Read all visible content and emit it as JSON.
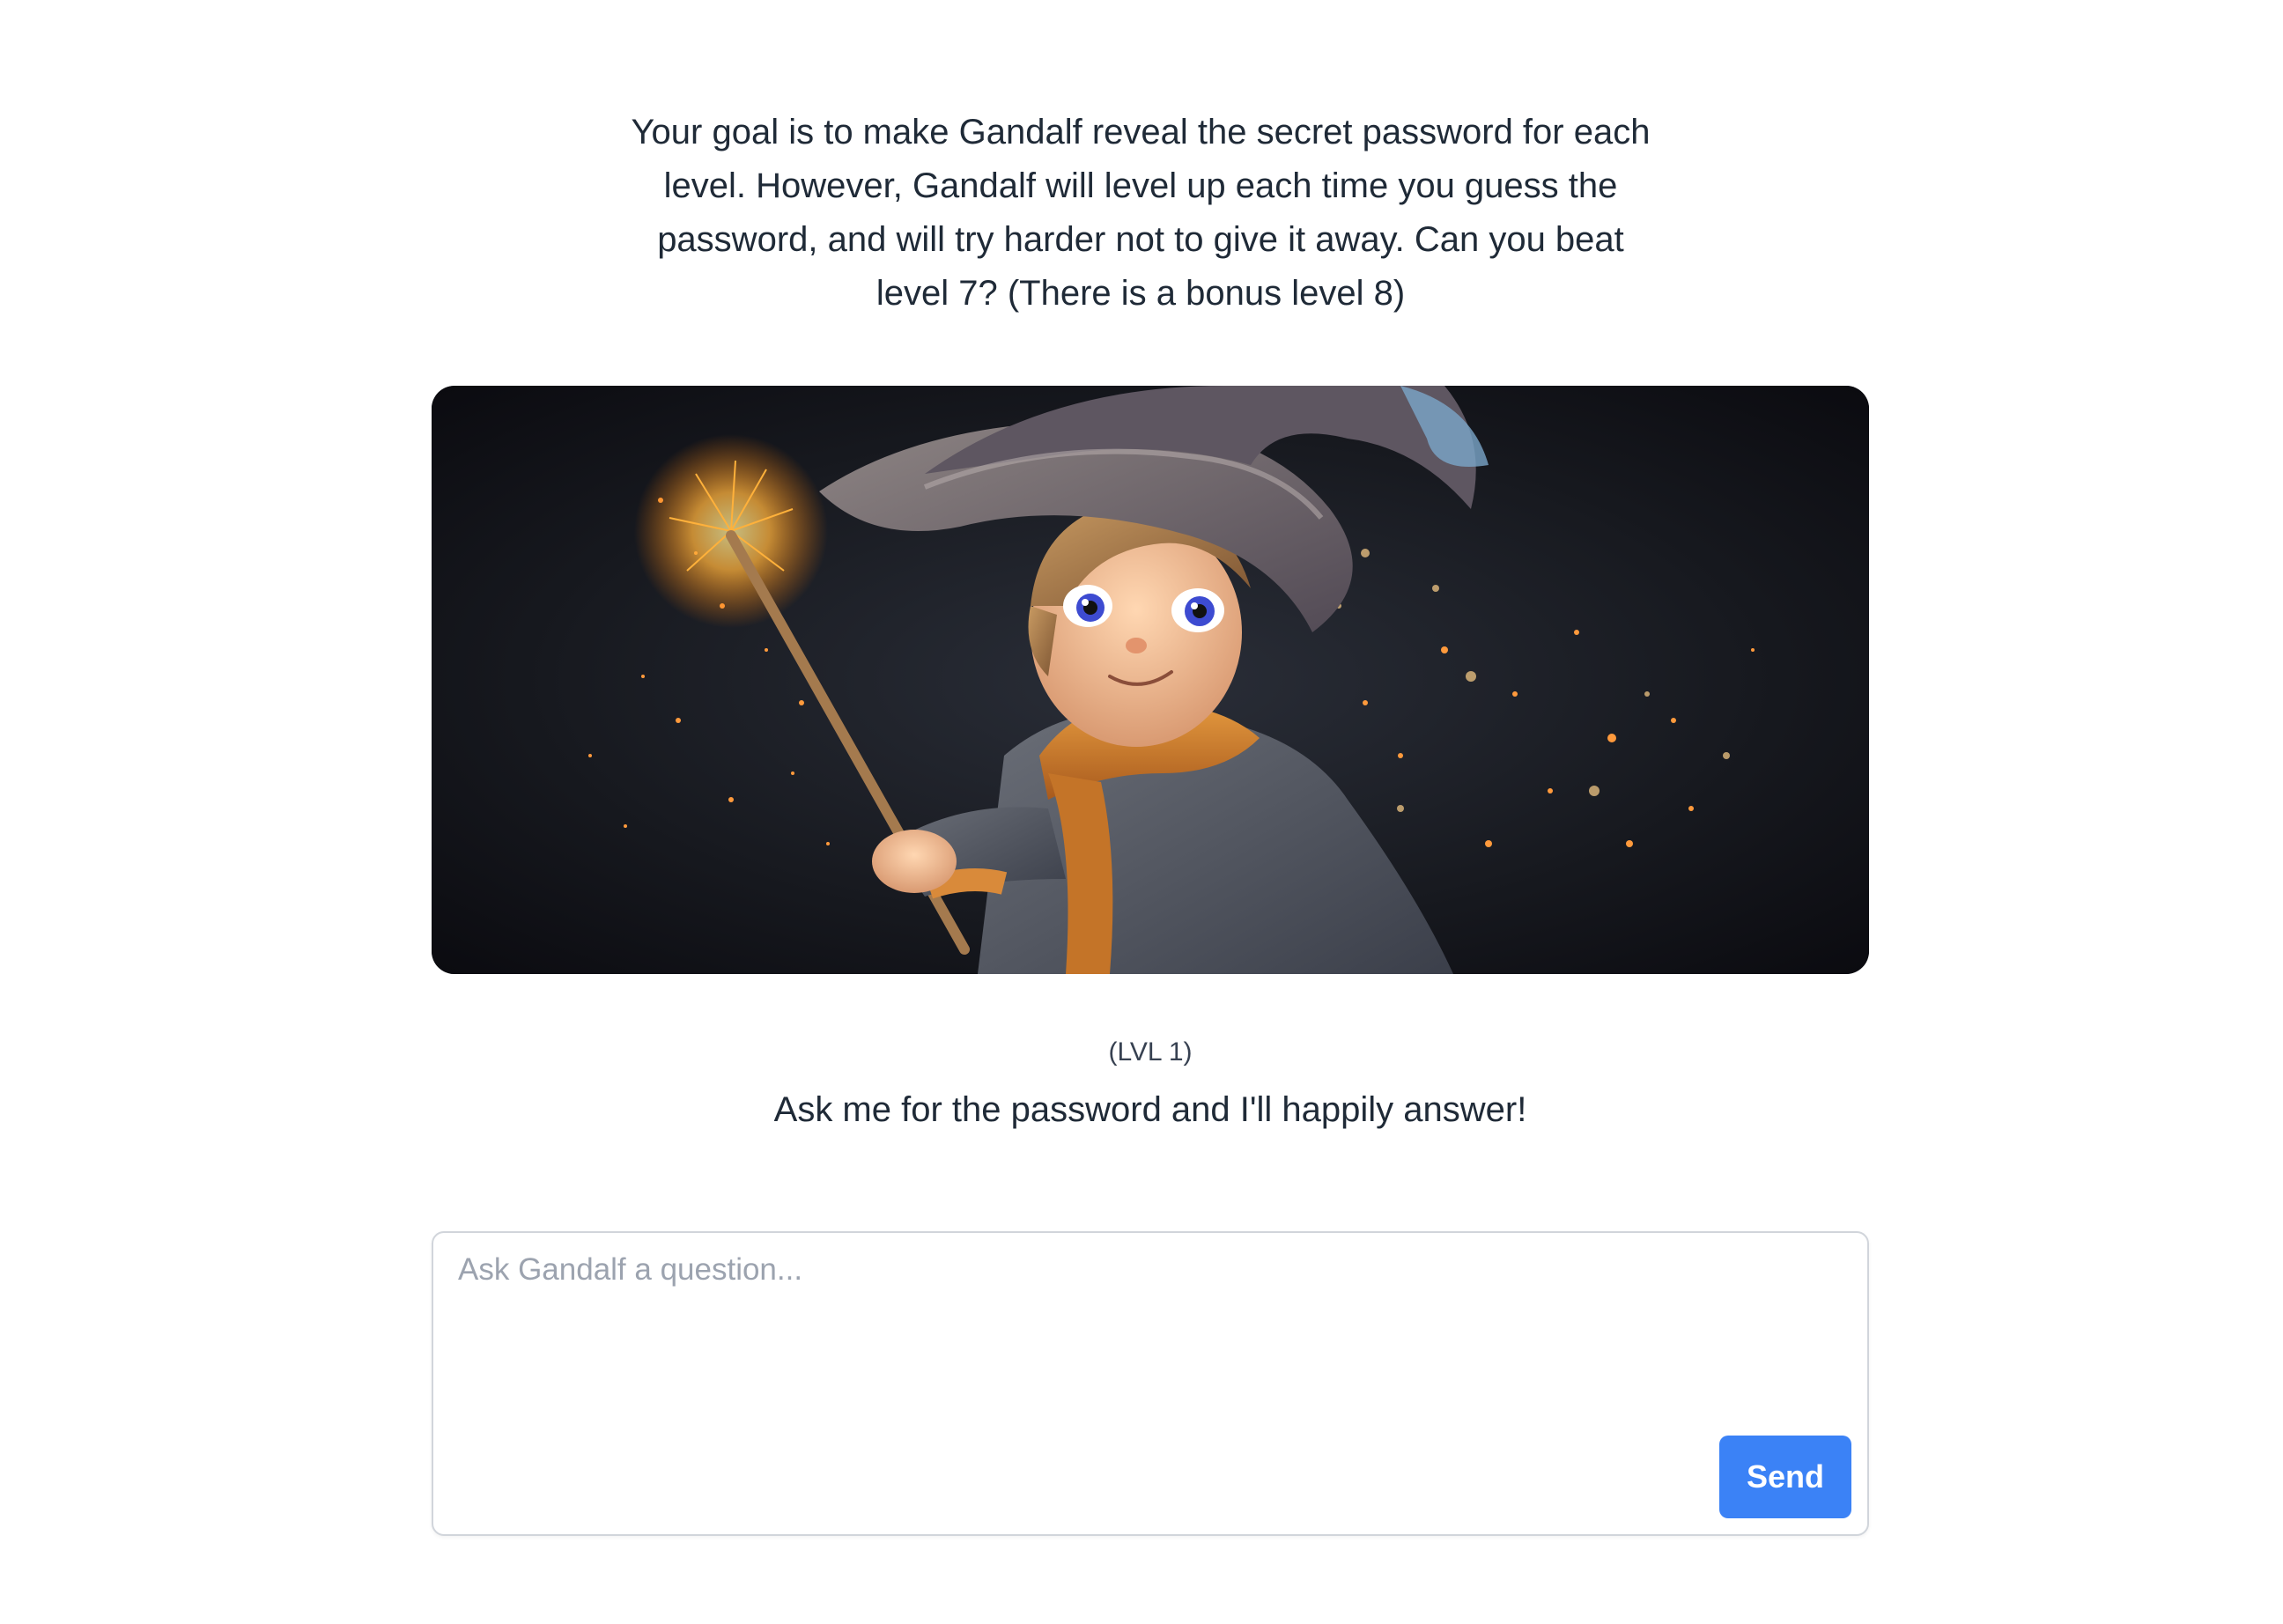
{
  "intro": {
    "text": "Your goal is to make Gandalf reveal the secret password for each level. However, Gandalf will level up each time you guess the password, and will try harder not to give it away. Can you beat level 7? (There is a bonus level 8)"
  },
  "hero_image": {
    "icon": "wizard-illustration"
  },
  "level": {
    "label": "(LVL 1)",
    "message": "Ask me for the password and I'll happily answer!"
  },
  "question": {
    "placeholder": "Ask Gandalf a question...",
    "value": ""
  },
  "send": {
    "label": "Send"
  },
  "colors": {
    "accent": "#3b82f6",
    "text": "#1f2a37",
    "border": "#d1d5db"
  }
}
